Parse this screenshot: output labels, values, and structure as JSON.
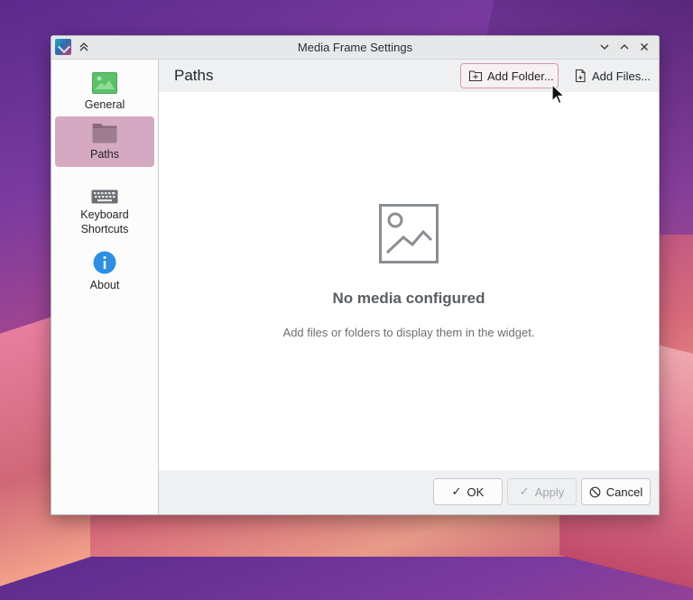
{
  "window": {
    "title": "Media Frame Settings"
  },
  "sidebar": {
    "items": [
      {
        "label": "General",
        "icon": "image-icon"
      },
      {
        "label": "Paths",
        "icon": "folder-icon",
        "active": true
      },
      {
        "label": "Keyboard\nShortcuts",
        "line1": "Keyboard",
        "line2": "Shortcuts",
        "icon": "keyboard-icon"
      },
      {
        "label": "About",
        "icon": "info-icon"
      }
    ]
  },
  "main": {
    "page_title": "Paths",
    "add_folder_label": "Add Folder...",
    "add_files_label": "Add Files...",
    "empty_title": "No media configured",
    "empty_subtitle": "Add files or folders to display them in the widget."
  },
  "footer": {
    "ok_label": "OK",
    "apply_label": "Apply",
    "cancel_label": "Cancel"
  },
  "colors": {
    "accent": "#d6a9c2",
    "highlight_border": "#d59ab0",
    "info_blue": "#2d8fe0"
  }
}
